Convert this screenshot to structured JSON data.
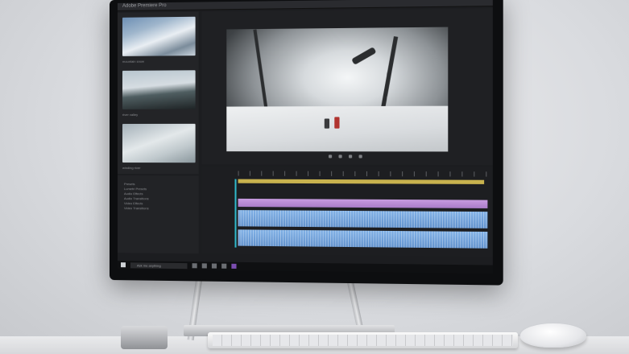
{
  "scene": {
    "object": "all-in-one desktop computer running a video editing application",
    "background_color": "#d9dbdf"
  },
  "screen": {
    "window_title": "Adobe Premiere Pro",
    "project_panel": {
      "thumbnails": [
        {
          "label": "mountain snow"
        },
        {
          "label": "river valley"
        },
        {
          "label": "winding river"
        }
      ]
    },
    "effects_panel": {
      "items": [
        "Presets",
        "Lumetri Presets",
        "Audio Effects",
        "Audio Transitions",
        "Video Effects",
        "Video Transitions"
      ]
    },
    "program_monitor": {
      "content": "snowboarder jumping in snowy forest"
    },
    "timeline": {
      "track_colors": {
        "video": "#c79be0",
        "audio": "#7fb0e6",
        "marker": "#c8b24e",
        "playhead": "#2fb7c9"
      }
    },
    "taskbar": {
      "search_placeholder": "Ask me anything"
    }
  },
  "peripherals": [
    "dial",
    "keyboard",
    "mouse"
  ]
}
